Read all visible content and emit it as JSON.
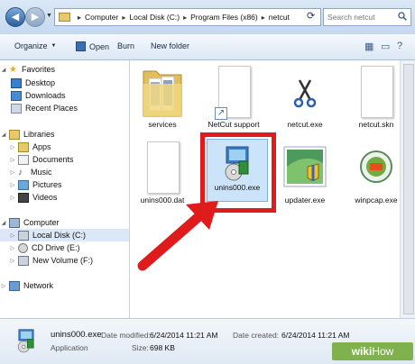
{
  "address_bar": {
    "breadcrumbs": [
      "Computer",
      "Local Disk (C:)",
      "Program Files (x86)",
      "netcut"
    ],
    "search_placeholder": "Search netcut"
  },
  "toolbar": {
    "organize": "Organize",
    "open": "Open",
    "burn": "Burn",
    "new_folder": "New folder"
  },
  "nav": {
    "favorites": "Favorites",
    "desktop": "Desktop",
    "downloads": "Downloads",
    "recent_places": "Recent Places",
    "libraries": "Libraries",
    "apps": "Apps",
    "documents": "Documents",
    "music": "Music",
    "pictures": "Pictures",
    "videos": "Videos",
    "computer": "Computer",
    "local_disk": "Local Disk (C:)",
    "cd_drive": "CD Drive (E:)",
    "new_volume": "New Volume (F:)",
    "network": "Network"
  },
  "files": [
    {
      "name": "services",
      "icon": "folder-icon"
    },
    {
      "name": "NetCut support",
      "icon": "shortcut-icon"
    },
    {
      "name": "netcut.exe",
      "icon": "scissors-app-icon"
    },
    {
      "name": "netcut.skn",
      "icon": "blank-file-icon"
    },
    {
      "name": "unins000.dat",
      "icon": "blank-file-icon"
    },
    {
      "name": "unins000.exe",
      "icon": "installer-icon"
    },
    {
      "name": "updater.exe",
      "icon": "shield-window-icon"
    },
    {
      "name": "winpcap.exe",
      "icon": "winpcap-icon"
    }
  ],
  "details": {
    "name": "unins000.exe",
    "type": "Application",
    "date_modified_label": "Date modified:",
    "date_modified": "6/24/2014 11:21 AM",
    "date_created_label": "Date created:",
    "date_created": "6/24/2014 11:21 AM",
    "size_label": "Size:",
    "size": "698 KB"
  },
  "watermark": {
    "bold": "wiki",
    "thin": "How"
  },
  "colors": {
    "highlight_box": "#e01b1b",
    "arrow": "#e01b1b",
    "selection": "#cce4fa",
    "watermark": "#7fb24c"
  }
}
